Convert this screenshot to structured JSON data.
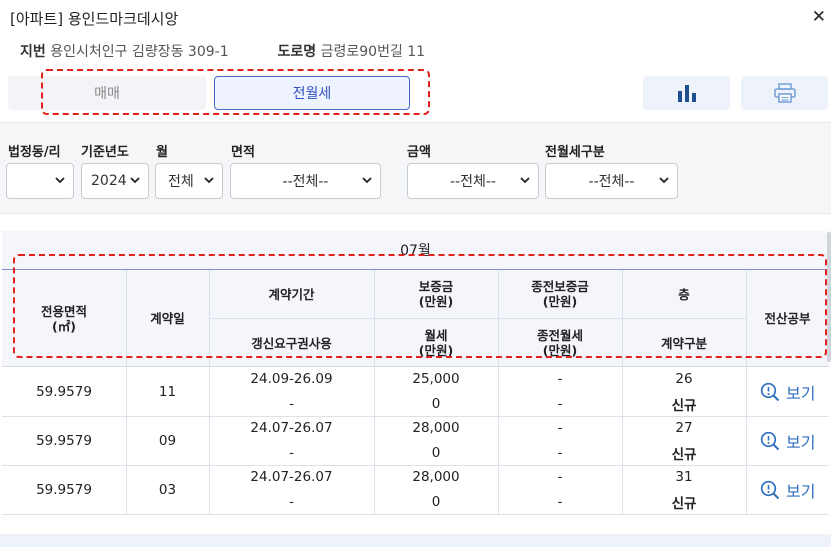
{
  "header": {
    "title": "[아파트] 용인드마크데시앙",
    "close_glyph": "✕"
  },
  "address": {
    "jibun_label": "지번",
    "jibun_value": "용인시처인구 김량장동 309-1",
    "road_label": "도로명",
    "road_value": "금령로90번길 11"
  },
  "tabs": [
    {
      "label": "매매",
      "active": false
    },
    {
      "label": "전월세",
      "active": true
    }
  ],
  "toolbar": {
    "chart_icon": "bar-chart-icon",
    "print_icon": "printer-icon"
  },
  "filters": {
    "dong": {
      "label": "법정동/리",
      "value": ""
    },
    "year": {
      "label": "기준년도",
      "value": "2024"
    },
    "month": {
      "label": "월",
      "value": "전체"
    },
    "area": {
      "label": "면적",
      "value": "--전체--"
    },
    "amount": {
      "label": "금액",
      "value": "--전체--"
    },
    "rent_type": {
      "label": "전월세구분",
      "value": "--전체--"
    }
  },
  "table": {
    "month_title": "07월",
    "headers": {
      "area": "전용면적\n(㎡)",
      "day": "계약일",
      "period": "계약기간",
      "deposit": "보증금\n(만원)",
      "prev_deposit": "종전보증금\n(만원)",
      "floor": "층",
      "register": "전산공부",
      "renewal": "갱신요구권사용",
      "monthly": "월세\n(만원)",
      "prev_monthly": "종전월세\n(만원)",
      "contract_type": "계약구분"
    },
    "view_label": "보기",
    "rows": [
      {
        "area": "59.9579",
        "day": "11",
        "period": "24.09-26.09",
        "renewal": "-",
        "deposit": "25,000",
        "monthly": "0",
        "prev_deposit": "-",
        "prev_monthly": "-",
        "floor": "26",
        "contract_type": "신규"
      },
      {
        "area": "59.9579",
        "day": "09",
        "period": "24.07-26.07",
        "renewal": "-",
        "deposit": "28,000",
        "monthly": "0",
        "prev_deposit": "-",
        "prev_monthly": "-",
        "floor": "27",
        "contract_type": "신규"
      },
      {
        "area": "59.9579",
        "day": "03",
        "period": "24.07-26.07",
        "renewal": "-",
        "deposit": "28,000",
        "monthly": "0",
        "prev_deposit": "-",
        "prev_monthly": "-",
        "floor": "31",
        "contract_type": "신규"
      }
    ]
  },
  "colors": {
    "accent": "#2f52c0",
    "highlight": "#e0211c",
    "link": "#2f6fc0",
    "icon": "#1f4f8f"
  }
}
